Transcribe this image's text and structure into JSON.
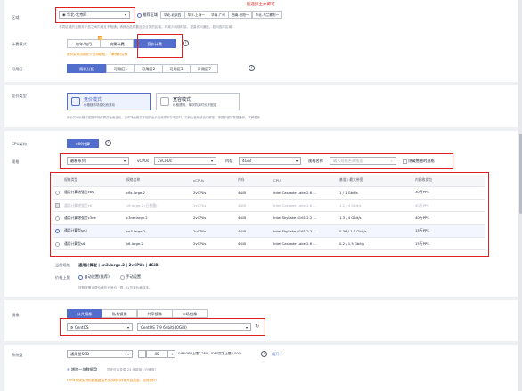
{
  "annotation": "一般选择主亦即可",
  "region": {
    "label": "区域",
    "selected": "华北-北京四",
    "quick_label": "推荐区域",
    "quick": [
      "华北-北京四",
      "华东-上海一",
      "华南-广州",
      "西南-贵阳一",
      "华北-乌兰察布一"
    ],
    "note": "不同区域的云服务产品之间内网互不相通；请就近选择靠近您业务的区域，可减少网络时延、提高访问速度。如何选择区域"
  },
  "billing": {
    "label": "计费模式",
    "options": [
      "包年/包月",
      "按需计费",
      "竞价计费"
    ],
    "badge": "惠",
    "note": "竞价实例当前处于公测阶段。了解竞价实例"
  },
  "az": {
    "label": "可用区",
    "options": [
      "随机分配",
      "可用区1",
      "可用区2",
      "可用区3",
      "可用区7"
    ]
  },
  "pricing": {
    "label": "竞价类型",
    "cards": [
      {
        "title": "竞价模式",
        "desc": "价格随市场变化而波动",
        "selected": true
      },
      {
        "title": "宽容模式",
        "desc": "价格透明，单次购买时长不固定",
        "selected": false
      }
    ],
    "note": "竞价实例价格可能随市场供需变化而波动，当市场价格高于您的出价或资源库存不足时，实例会被系统自动释放，请提前做好数据备份。了解更多"
  },
  "cpu_arch": {
    "label": "CPU架构",
    "value": "x86计算"
  },
  "spec": {
    "label": "规格",
    "family": "最新系列",
    "vcpus_label": "vCPUs",
    "vcpus": "2vCPUs",
    "mem_label": "内存",
    "mem": "4GiB",
    "name_label": "规格名称",
    "name_placeholder": "输入规格名称搜索",
    "hide_label": "隐藏售罄的规格"
  },
  "table": {
    "headers": [
      "规格类型",
      "规格名称",
      "vCPUs",
      "内存",
      "CPU",
      "基准 / 最大带宽",
      "内网收发包"
    ],
    "rows": [
      [
        "通用计算增强型c6s",
        "c6s.large.2",
        "2vCPUs",
        "4GiB",
        "Intel Cascade Lake 2.6 ...",
        "1 / 1 Gbit/s",
        "30万PPS"
      ],
      [
        "通用计算增强型c6",
        "c6.large.2 (已售罄)",
        "2vCPUs",
        "4GiB",
        "Intel Cascade Lake 2.6 ...",
        "1.2 / 4 Gbit/s",
        "40万PPS"
      ],
      [
        "通用计算增强型c3ne",
        "c3ne.large.2",
        "2vCPUs",
        "4GiB",
        "Intel SkyLake 6161 2.2 ...",
        "1.3 / 4 Gbit/s",
        "40万PPS"
      ],
      [
        "通用计算型sn3",
        "sn3.large.2",
        "2vCPUs",
        "4GiB",
        "Intel SkyLake 6161 2.2 ...",
        "0.36 / 1.5 Gbit/s",
        "15万PPS"
      ],
      [
        "通用计算型s6",
        "s6.large.2",
        "2vCPUs",
        "4GiB",
        "Intel Cascade Lake 2.6 ...",
        "0.2 / 1.5 Gbit/s",
        "15万PPS"
      ]
    ]
  },
  "current": {
    "label": "当前规格",
    "value": "通用计算型 | sn3.large.2 | 2vCPUs | 4GiB"
  },
  "price_cap": {
    "label": "价格上限",
    "options": [
      "自动设置(推荐)",
      "手动设置"
    ],
    "note": "按照按需计费价格作为竞价上限，以节省价格成本。"
  },
  "image": {
    "label": "镜像",
    "tabs": [
      "公共镜像",
      "私有镜像",
      "共享镜像",
      "市场镜像"
    ],
    "os": "CentOS",
    "version": "CentOS 7.9 64bit(40GiB)"
  },
  "disk": {
    "label": "系统盘",
    "type": "通用型SSD",
    "size": "40",
    "unit": "GiB IOPS上限2,280，IOPS突发上限8,000",
    "more": "展开",
    "add": "增加一块数据盘",
    "add_note": "您还可以挂载 23 块磁盘（云硬盘）",
    "warn": "Linux系统实例的数据盘暂不支持同时存储开启加密。如何操作?"
  }
}
